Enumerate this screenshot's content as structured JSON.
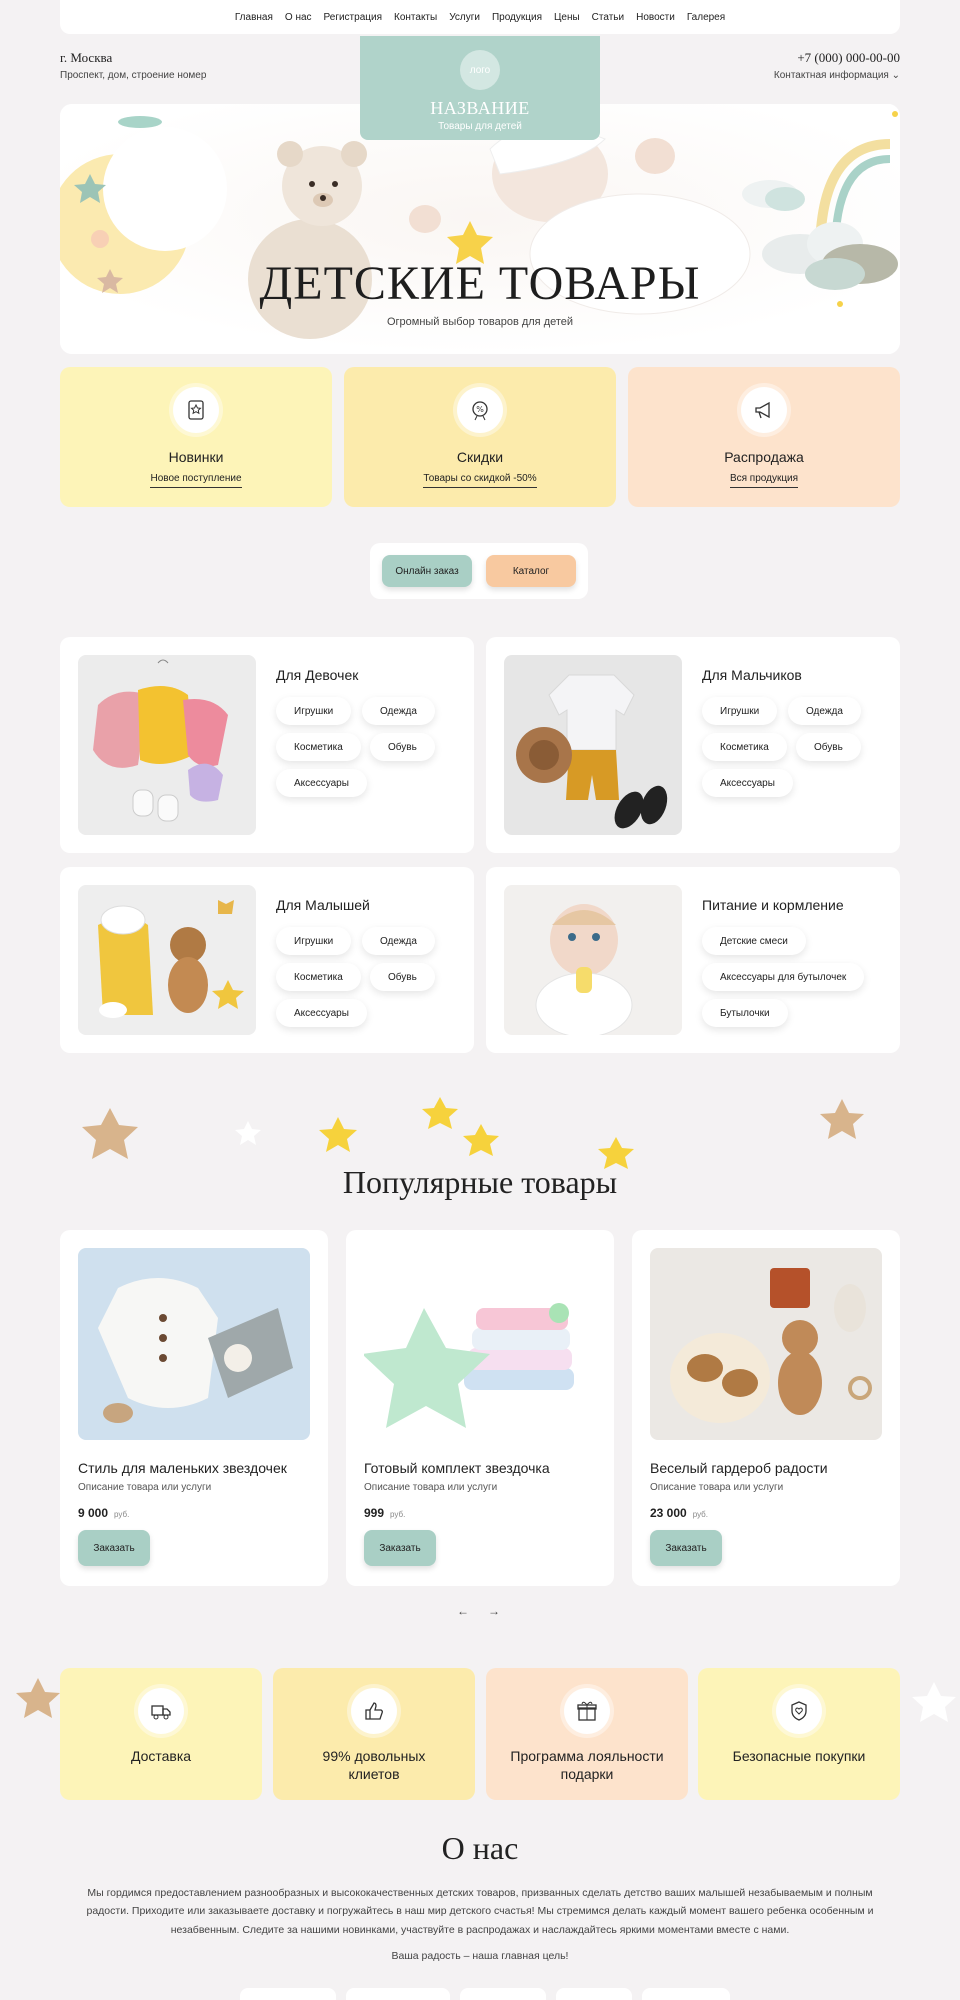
{
  "nav": [
    "Главная",
    "О нас",
    "Регистрация",
    "Контакты",
    "Услуги",
    "Продукция",
    "Цены",
    "Статьи",
    "Новости",
    "Галерея"
  ],
  "header": {
    "city": "г. Москва",
    "address": "Проспект, дом, строение номер",
    "phone": "+7 (000) 000-00-00",
    "contact_info": "Контактная информация ⌄"
  },
  "logo": {
    "badge": "лого",
    "name": "НАЗВАНИЕ",
    "subtitle": "Товары для детей"
  },
  "hero": {
    "title": "ДЕТСКИЕ ТОВАРЫ",
    "subtitle": "Огромный выбор товаров для детей"
  },
  "features": [
    {
      "title": "Новинки",
      "link": "Новое поступление",
      "color": "#fdf4b8",
      "icon": "new-badge-icon"
    },
    {
      "title": "Скидки",
      "link": "Товары со скидкой -50%",
      "color": "#fcebac",
      "icon": "discount-icon"
    },
    {
      "title": "Распродажа",
      "link": "Вся продукция",
      "color": "#fde3cc",
      "icon": "sale-megaphone-icon"
    }
  ],
  "actions": {
    "online_order": "Онлайн заказ",
    "catalog": "Каталог"
  },
  "categories": [
    {
      "title": "Для Девочек",
      "tags": [
        "Игрушки",
        "Одежда",
        "Косметика",
        "Обувь",
        "Аксессуары"
      ]
    },
    {
      "title": "Для Мальчиков",
      "tags": [
        "Игрушки",
        "Одежда",
        "Косметика",
        "Обувь",
        "Аксессуары"
      ]
    },
    {
      "title": "Для Малышей",
      "tags": [
        "Игрушки",
        "Одежда",
        "Косметика",
        "Обувь",
        "Аксессуары"
      ]
    },
    {
      "title": "Питание и кормление",
      "tags": [
        "Детские смеси",
        "Аксессуары для бутылочек",
        "Бутылочки"
      ]
    }
  ],
  "popular": {
    "title": "Популярные товары",
    "products": [
      {
        "name": "Стиль для маленьких звездочек",
        "desc": "Описание товара или услуги",
        "price": "9 000",
        "currency": "руб.",
        "button": "Заказать"
      },
      {
        "name": "Готовый комплект звездочка",
        "desc": "Описание товара или услуги",
        "price": "999",
        "currency": "руб.",
        "button": "Заказать"
      },
      {
        "name": "Веселый гардероб радости",
        "desc": "Описание товара или услуги",
        "price": "23 000",
        "currency": "руб.",
        "button": "Заказать"
      }
    ],
    "prev": "←",
    "next": "→"
  },
  "benefits": [
    {
      "title": "Доставка",
      "color": "#fdf4b8",
      "icon": "delivery-truck-icon"
    },
    {
      "title": "99% довольных клиетов",
      "color": "#fcebac",
      "icon": "thumbs-up-icon"
    },
    {
      "title": "Программа лояльности подарки",
      "color": "#fde3cc",
      "icon": "gift-icon"
    },
    {
      "title": "Безопасные покупки",
      "color": "#fdf4b8",
      "icon": "shield-heart-icon"
    }
  ],
  "about": {
    "title": "О нас",
    "text": "Мы гордимся предоставлением разнообразных и высококачественных детских товаров, призванных сделать детство ваших малышей незабываемым и полным радости. Приходите или заказываете доставку и погружайтесь в наш мир детского счастья! Мы стремимся делать каждый момент вашего ребенка особенным и незабвенным. Следите за нашими новинками, участвуйте в распродажах и наслаждайтесь яркими моментами вместе с нами.",
    "motto": "Ваша радость – наша главная цель!"
  },
  "colors": {
    "mint": "#a9cfc5",
    "peach": "#f8c9a0",
    "background": "#f4f2f3"
  }
}
